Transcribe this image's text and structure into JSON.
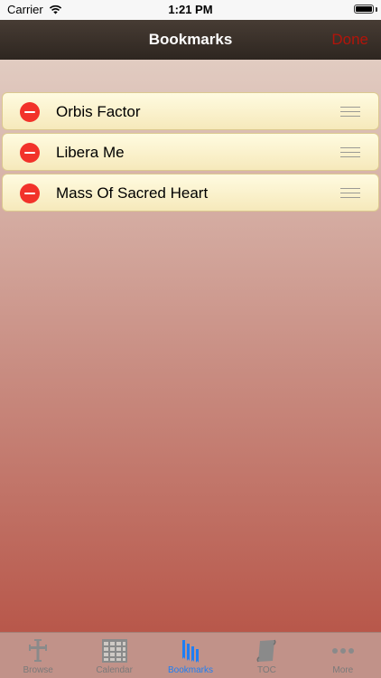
{
  "status_bar": {
    "carrier": "Carrier",
    "time": "1:21 PM",
    "wifi_icon": "wifi-icon",
    "battery_icon": "battery-icon"
  },
  "nav": {
    "title": "Bookmarks",
    "done_label": "Done"
  },
  "bookmarks": [
    {
      "label": "Orbis Factor"
    },
    {
      "label": "Libera Me"
    },
    {
      "label": "Mass Of Sacred Heart"
    }
  ],
  "tabs": [
    {
      "label": "Browse",
      "icon": "cross-icon",
      "active": false
    },
    {
      "label": "Calendar",
      "icon": "calendar-icon",
      "active": false
    },
    {
      "label": "Bookmarks",
      "icon": "bookmarks-icon",
      "active": true
    },
    {
      "label": "TOC",
      "icon": "scroll-icon",
      "active": false
    },
    {
      "label": "More",
      "icon": "more-icon",
      "active": false
    }
  ],
  "colors": {
    "done": "#b3140a",
    "active_tab": "#1f7ef4",
    "delete": "#f2322a"
  }
}
